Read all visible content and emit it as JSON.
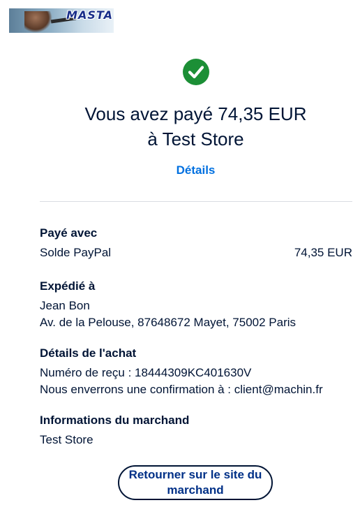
{
  "logo": {
    "text": "MASTA"
  },
  "status": {
    "icon": "check-circle-icon",
    "color": "#1c8f36"
  },
  "headline": {
    "line1": "Vous avez payé 74,35 EUR",
    "line2": "à Test Store"
  },
  "details_link": "Détails",
  "paid_with": {
    "title": "Payé avec",
    "method": "Solde PayPal",
    "amount": "74,35 EUR"
  },
  "shipped_to": {
    "title": "Expédié à",
    "name": "Jean Bon",
    "address": "Av. de la Pelouse, 87648672 Mayet, 75002 Paris"
  },
  "purchase_details": {
    "title": "Détails de l'achat",
    "receipt": "Numéro de reçu : 18444309KC401630V",
    "confirmation": "Nous enverrons une confirmation à : client@machin.fr"
  },
  "merchant_info": {
    "title": "Informations du marchand",
    "name": "Test Store"
  },
  "return_button": "Retourner sur le site du marchand",
  "colors": {
    "text": "#001435",
    "link": "#0070e0",
    "button_text": "#003087"
  }
}
